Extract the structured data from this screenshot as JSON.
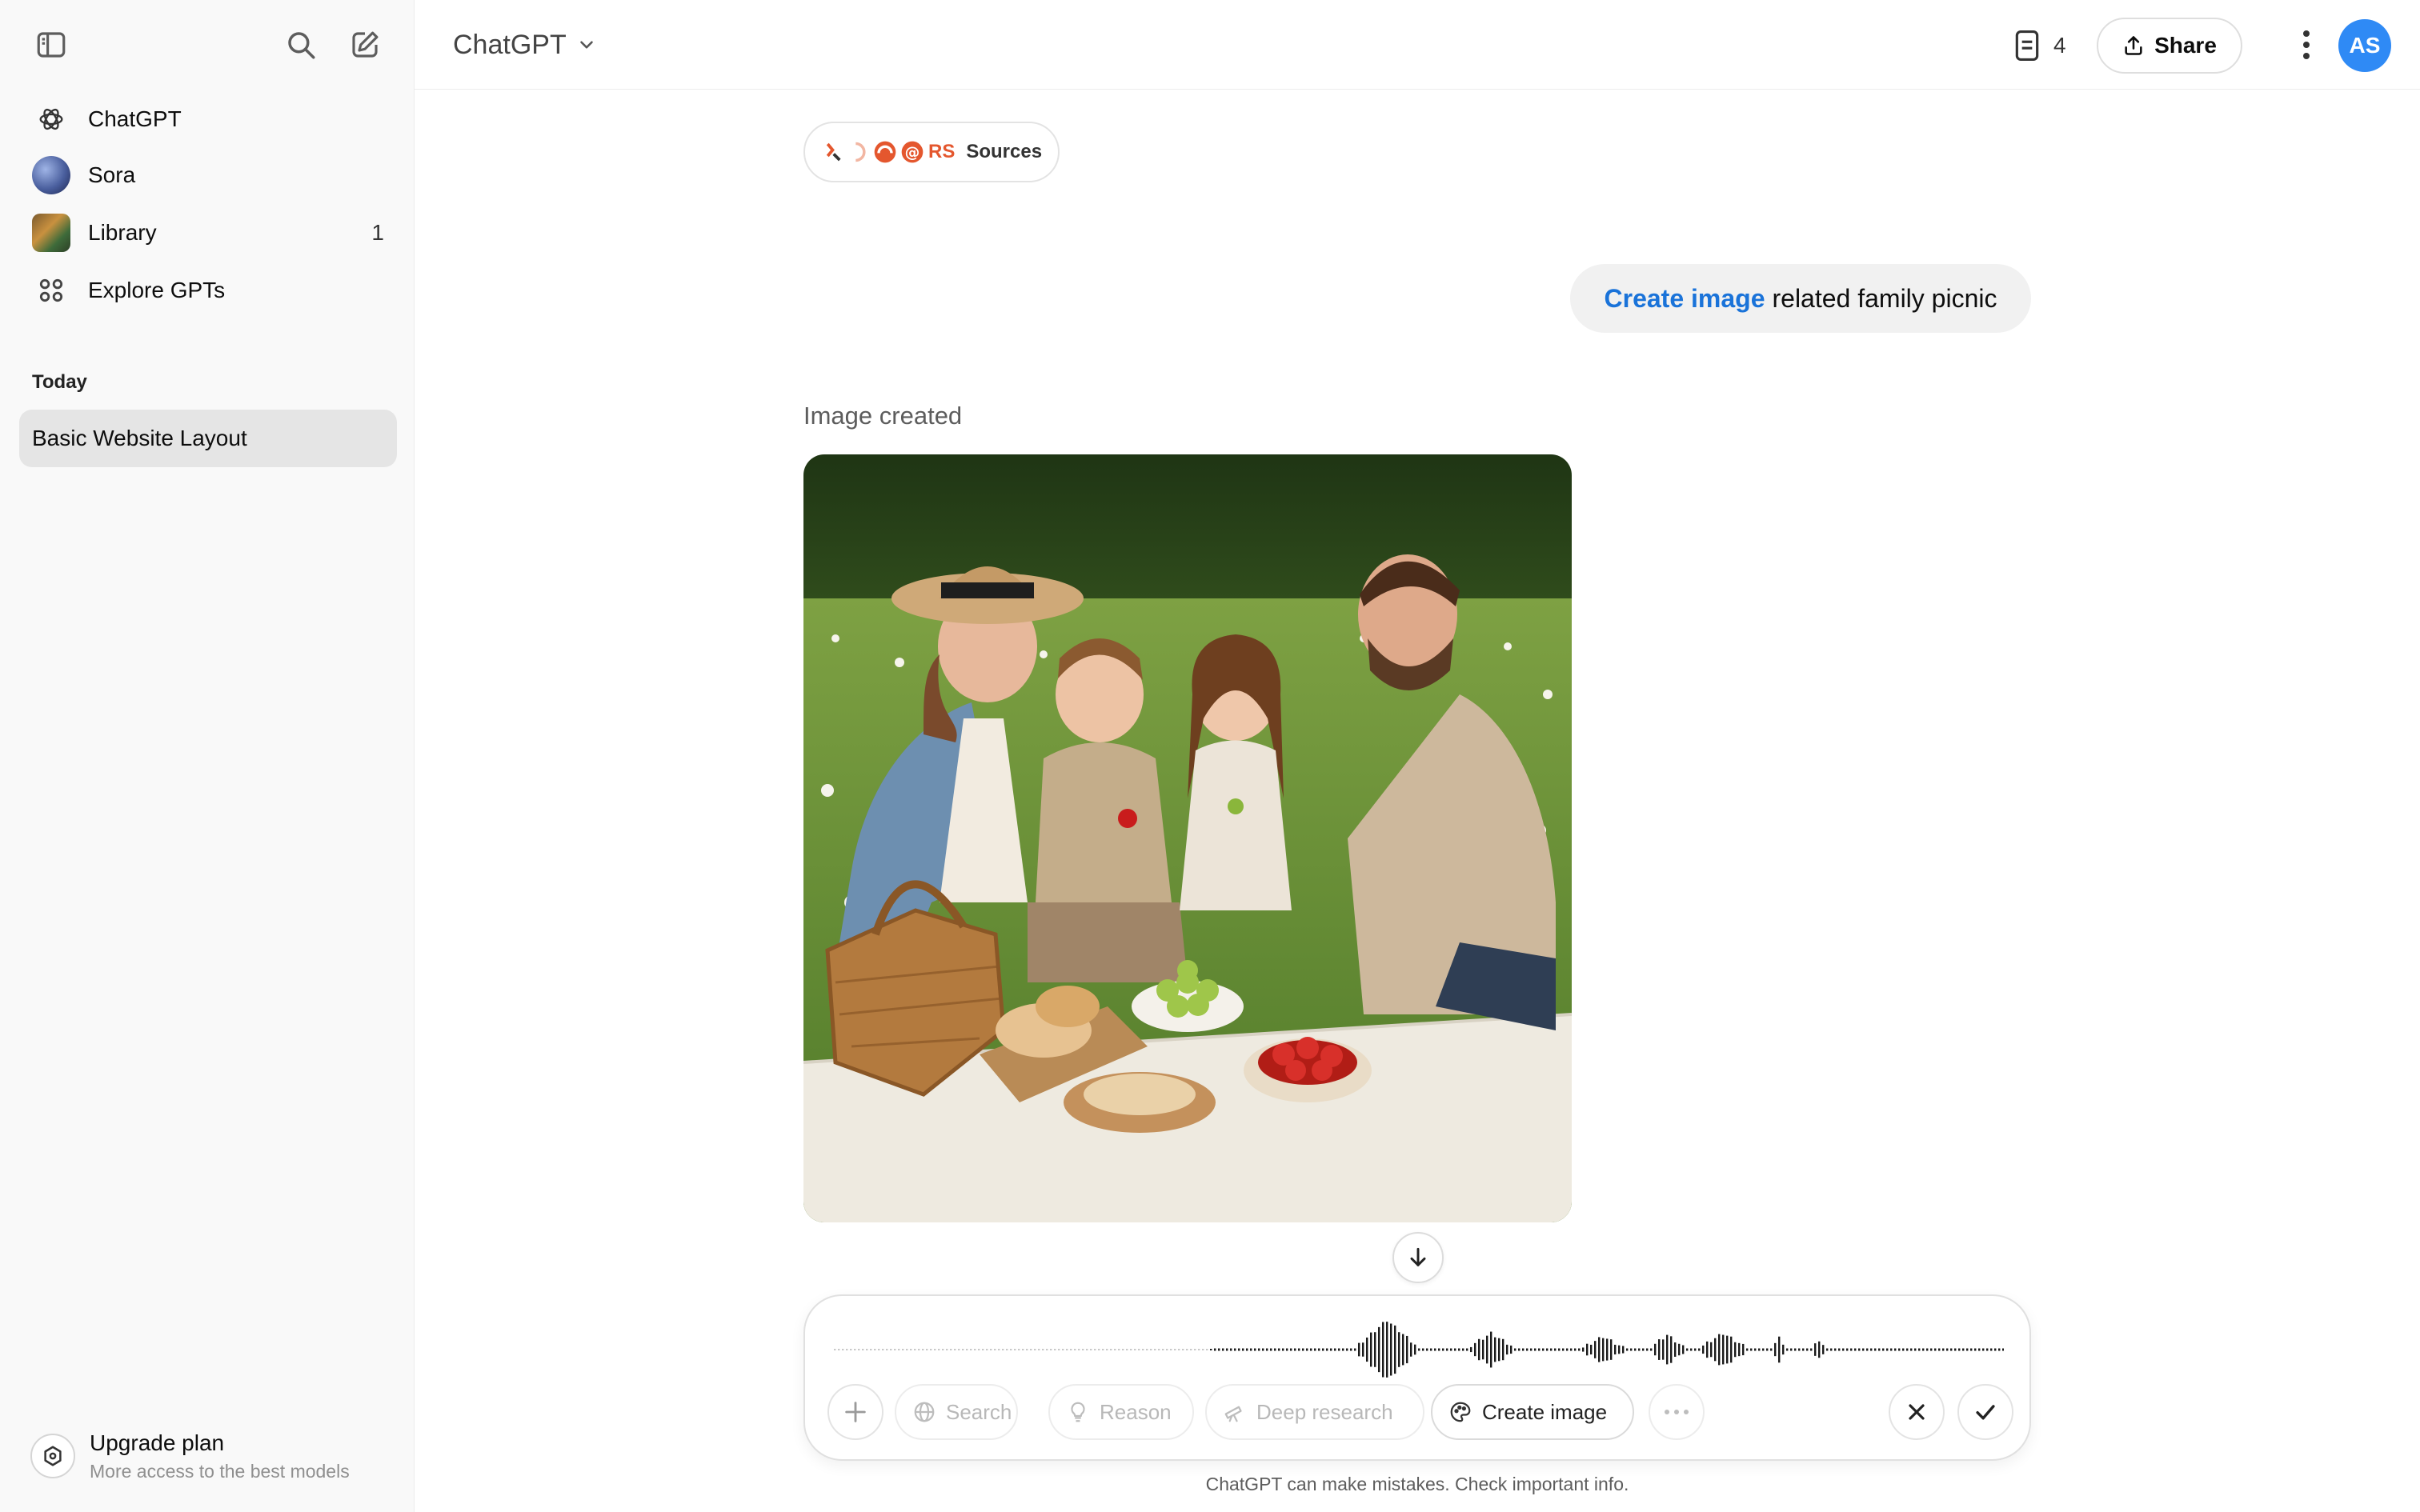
{
  "sidebar": {
    "items": [
      {
        "label": "ChatGPT",
        "count": ""
      },
      {
        "label": "Sora",
        "count": ""
      },
      {
        "label": "Library",
        "count": "1"
      },
      {
        "label": "Explore GPTs",
        "count": ""
      }
    ],
    "section_today": "Today",
    "history": [
      {
        "label": "Basic Website Layout"
      }
    ],
    "upgrade": {
      "title": "Upgrade plan",
      "subtitle": "More access to the best models"
    }
  },
  "header": {
    "model_name": "ChatGPT",
    "doc_count": "4",
    "share_label": "Share",
    "avatar_initials": "AS"
  },
  "conversation": {
    "sources_label": "Sources",
    "sources_badge_text": "RS",
    "user_message": {
      "tool": "Create image",
      "text": "related family picnic"
    },
    "assistant_status": "Image created"
  },
  "composer": {
    "tools": [
      {
        "label": "Search",
        "icon": "globe-icon",
        "state": "disabled"
      },
      {
        "label": "Reason",
        "icon": "lightbulb-icon",
        "state": "disabled"
      },
      {
        "label": "Deep research",
        "icon": "telescope-icon",
        "state": "disabled"
      },
      {
        "label": "Create image",
        "icon": "palette-icon",
        "state": "active"
      }
    ]
  },
  "disclaimer": "ChatGPT can make mistakes. Check important info.",
  "colors": {
    "accent_blue": "#1a73d9",
    "avatar_blue": "#2f8af5",
    "sidebar_bg": "#f9f9f9",
    "selected_bg": "#e5e5e5"
  }
}
